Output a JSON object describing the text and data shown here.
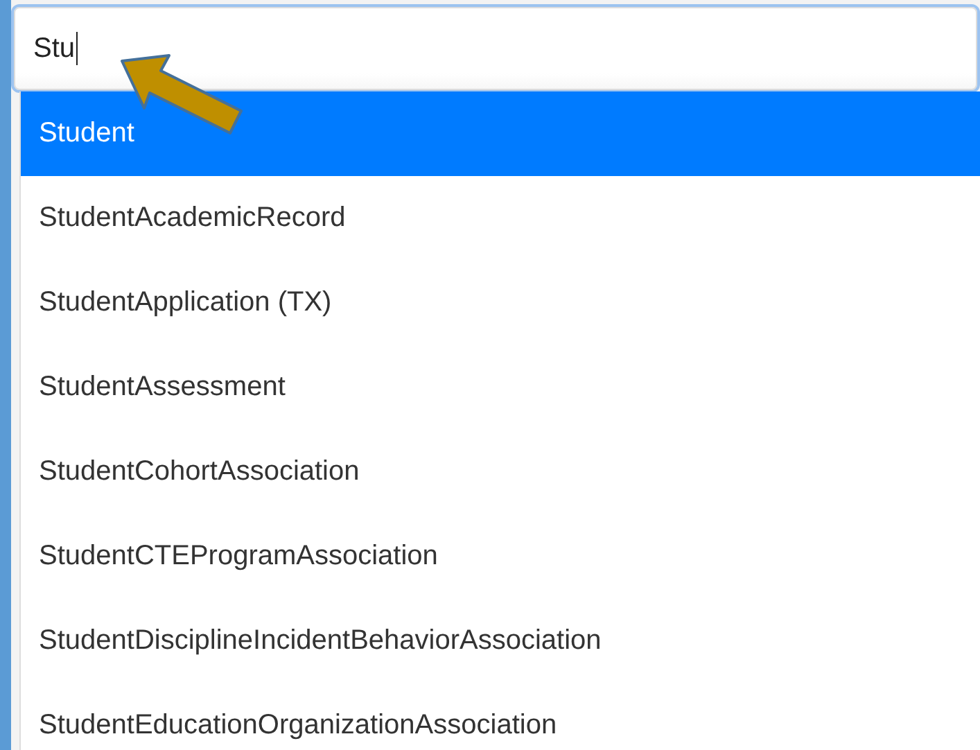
{
  "search": {
    "value": "Stu"
  },
  "suggestions": [
    {
      "label": "Student",
      "selected": true
    },
    {
      "label": "StudentAcademicRecord",
      "selected": false
    },
    {
      "label": "StudentApplication (TX)",
      "selected": false
    },
    {
      "label": "StudentAssessment",
      "selected": false
    },
    {
      "label": "StudentCohortAssociation",
      "selected": false
    },
    {
      "label": "StudentCTEProgramAssociation",
      "selected": false
    },
    {
      "label": "StudentDisciplineIncidentBehaviorAssociation",
      "selected": false
    },
    {
      "label": "StudentEducationOrganizationAssociation",
      "selected": false
    }
  ]
}
